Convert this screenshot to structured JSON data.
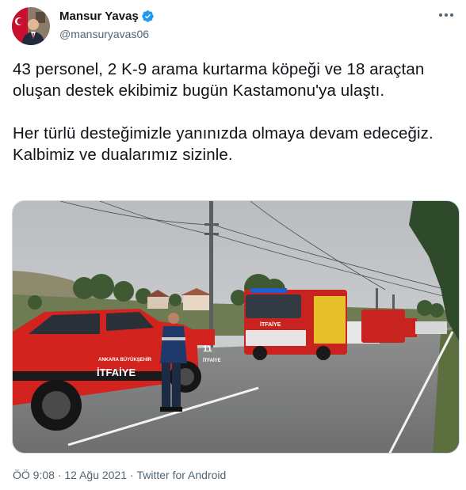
{
  "author": {
    "display_name": "Mansur Yavaş",
    "handle": "@mansuryavas06",
    "verified_icon": "verified-badge-icon",
    "avatar_icon": "profile-photo",
    "more_icon": "more-options-icon"
  },
  "tweet": {
    "paragraphs": [
      "43 personel, 2 K-9 arama kurtarma köpeği ve 18 araçtan oluşan destek ekibimiz bugün Kastamonu'ya ulaştı.",
      "Her türlü desteğimizle yanınızda olmaya devam edeceğiz. Kalbimiz ve dualarımız sizinle."
    ]
  },
  "media": {
    "truck_door_text_1": "ANKARA BÜYÜKŞEHİR",
    "truck_door_text_2": "İTFAİYE",
    "truck_number": "11",
    "truck_rear_text": "İTFAİYE",
    "fire_truck_cab_text": "İTFAİYE"
  },
  "meta": {
    "time": "ÖÖ 9:08",
    "separator": " · ",
    "date": "12 Ağu 2021",
    "source": "Twitter for Android"
  },
  "colors": {
    "verified": "#1d9bf0",
    "secondary_text": "#536471",
    "truck_red": "#d2231f",
    "border": "#cfd9de"
  }
}
